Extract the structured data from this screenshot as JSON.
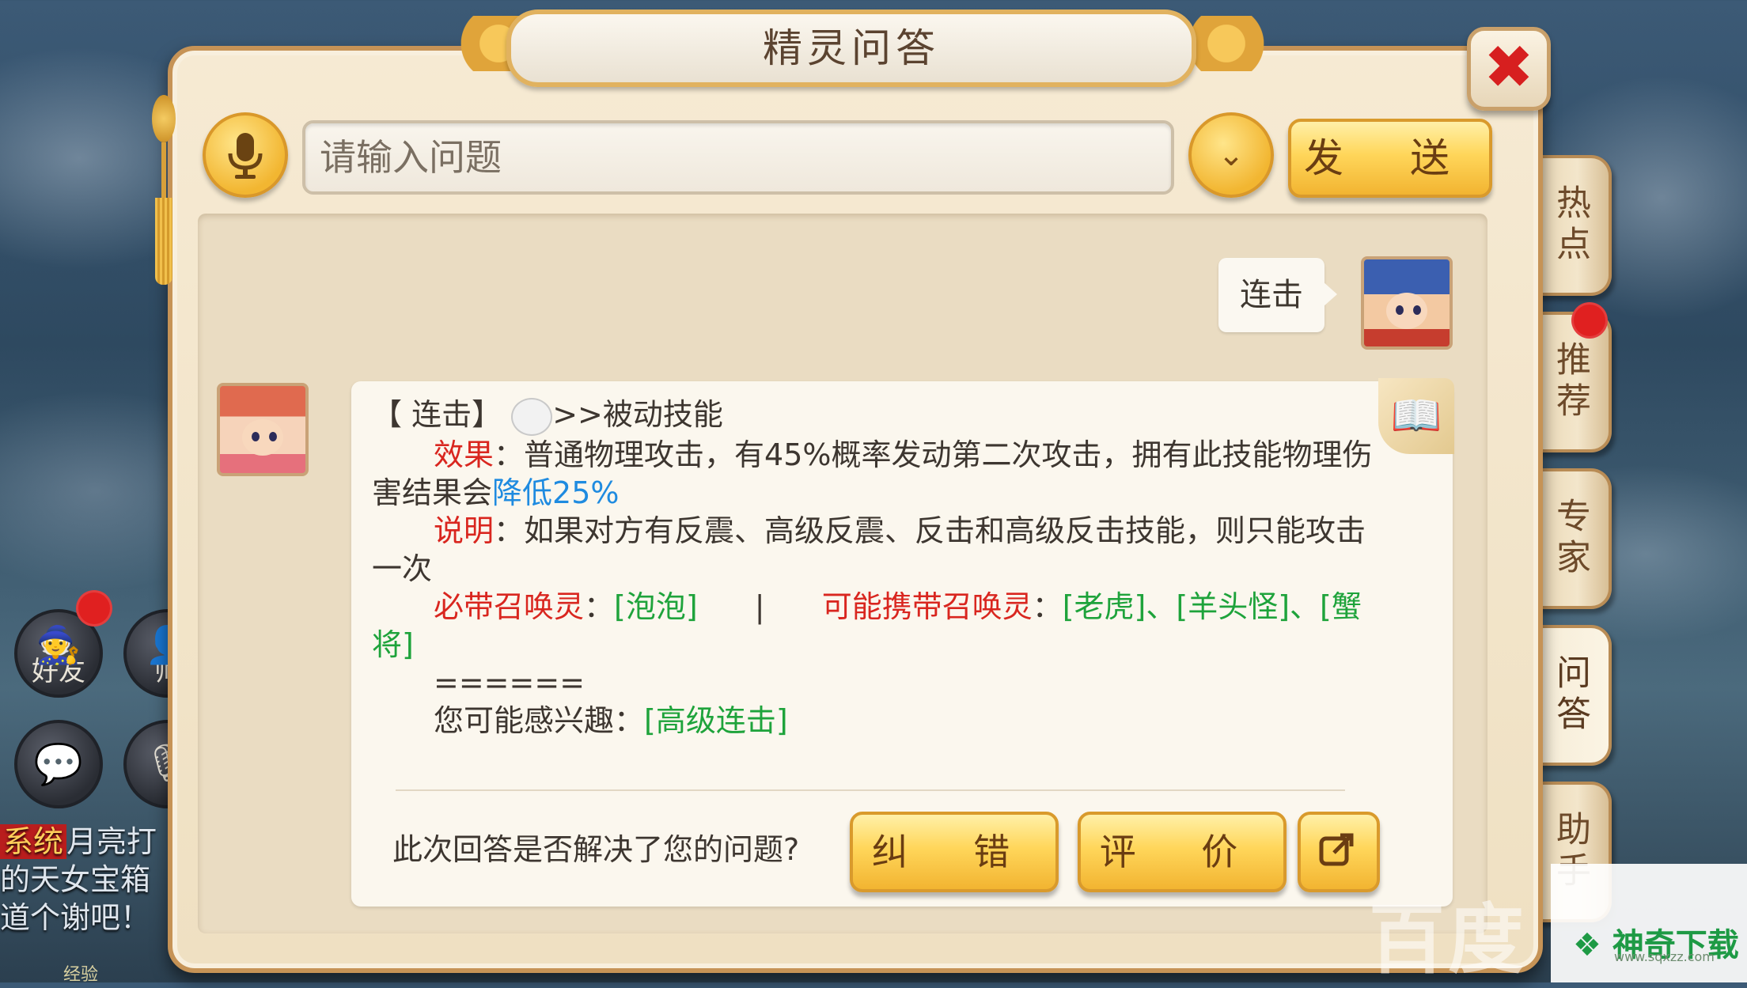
{
  "title": "精灵问答",
  "close_glyph": "✖",
  "input": {
    "placeholder": "请输入问题",
    "value": ""
  },
  "send_label": "发 送",
  "dropdown_glyph": "⌄",
  "side_tabs": [
    "热点",
    "推荐",
    "专家",
    "问答",
    "助手"
  ],
  "background": {
    "friend_label": "好友",
    "master_label": "师",
    "chat_tag": "系统",
    "chat_lines": [
      "月亮打",
      "的天女宝箱",
      "道个谢吧！"
    ],
    "exp_label": "经验"
  },
  "user_question": "连击",
  "answer": {
    "skill_name": "【 连击】",
    "skill_type": ">>被动技能",
    "effect_label": "效果",
    "effect_text_1": "：普通物理攻击，有45%概率发动第二次攻击，拥有此技能物理伤",
    "effect_text_2": "害结果会",
    "effect_highlight": "降低25%",
    "note_label": "说明",
    "note_text_1": "：如果对方有反震、高级反震、反击和高级反击技能，则只能攻击",
    "note_text_2": "一次",
    "must_label": "必带召唤灵",
    "must_colon": "：",
    "must_value": "[泡泡]",
    "separator": "|",
    "maybe_label": "可能携带召唤灵",
    "maybe_colon": "：",
    "maybe_values": "[老虎]、[羊头怪]、[蟹",
    "maybe_values_2": "将]",
    "divider": "======",
    "interest_label": "您可能感兴趣：",
    "interest_value": "[高级连击]"
  },
  "feedback_question": "此次回答是否解决了您的问题?",
  "fix_label": "纠 错",
  "rate_label": "评 价",
  "watermark": {
    "baidu": "百度",
    "site": "神奇下载",
    "url": "www.sqxzz.com"
  }
}
